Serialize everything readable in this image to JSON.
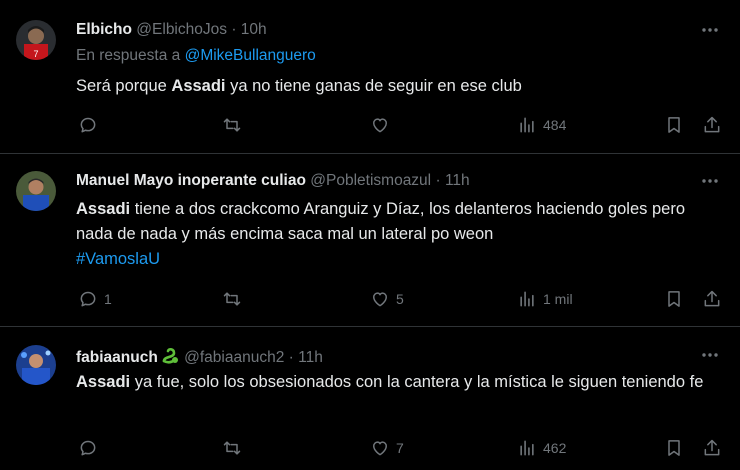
{
  "tweets": [
    {
      "name": "Elbicho",
      "handle": "@ElbichoJos",
      "separator": "·",
      "time": "10h",
      "reply_prefix": "En respuesta a",
      "reply_handle": "@MikeBullanguero",
      "text_pre": "Será porque ",
      "text_bold": "Assadi",
      "text_post": " ya no tiene ganas de seguir en ese club",
      "hashtag": "",
      "replies": "",
      "retweets": "",
      "likes": "",
      "views": "484"
    },
    {
      "name": "Manuel Mayo inoperante culiao",
      "handle": "@Pobletismoazul",
      "separator": "·",
      "time": "11h",
      "text_pre": "",
      "text_bold": "Assadi",
      "text_post": " tiene a dos crackcomo Aranguiz y Díaz, los delanteros haciendo goles pero nada de nada  y más encima saca mal un lateral po weon",
      "hashtag": "#VamoslaU",
      "replies": "1",
      "retweets": "",
      "likes": "5",
      "views": "1 mil"
    },
    {
      "name": "fabiaanuch",
      "name_flair_icon": "snake-emoji",
      "handle": "@fabiaanuch2",
      "separator": "·",
      "time": "11h",
      "text_pre": "",
      "text_bold": "Assadi",
      "text_post": " ya fue, solo los obsesionados con la cantera y la mística le siguen teniendo fe",
      "hashtag": "",
      "replies": "",
      "retweets": "",
      "likes": "7",
      "views": "462"
    }
  ],
  "colors": {
    "background": "#000000",
    "text": "#e7e9ea",
    "muted": "#71767b",
    "link": "#1d9bf0",
    "divider": "#2f3336"
  }
}
